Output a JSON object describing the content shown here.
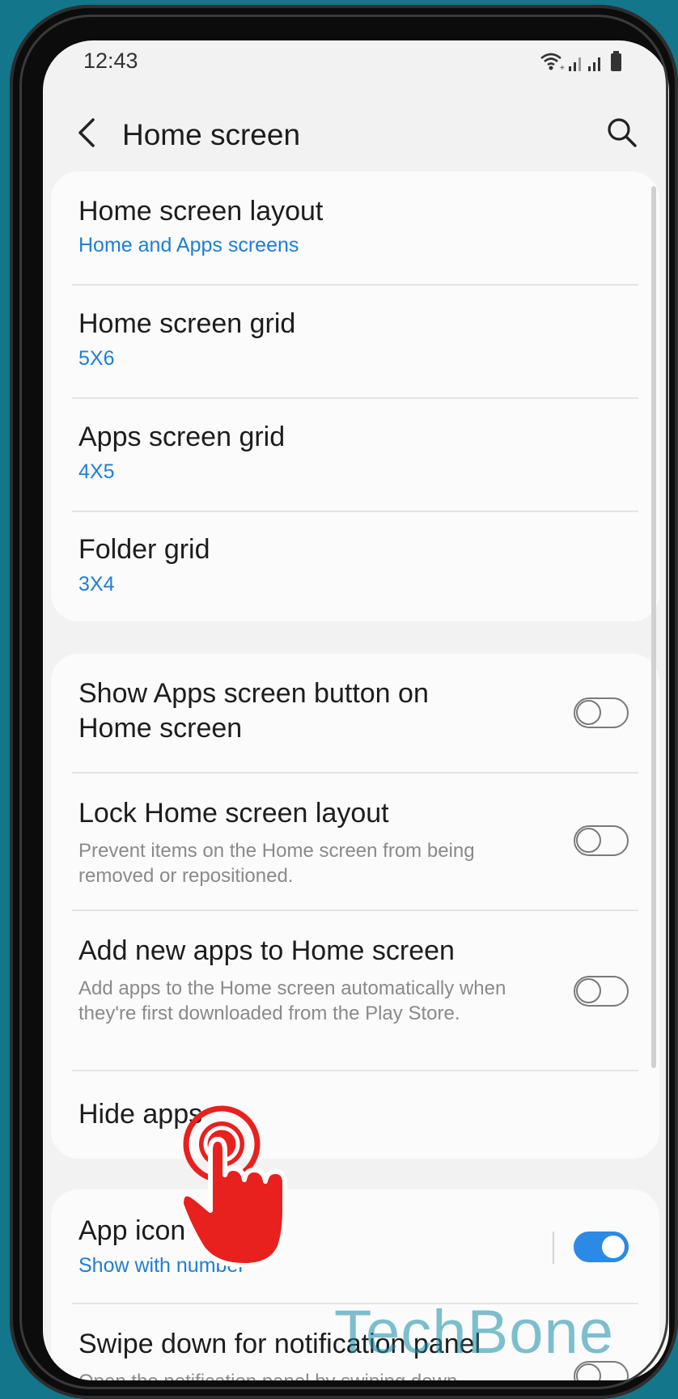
{
  "status_bar": {
    "time": "12:43"
  },
  "header": {
    "title": "Home screen"
  },
  "card1": [
    {
      "title": "Home screen layout",
      "value": "Home and Apps screens"
    },
    {
      "title": "Home screen grid",
      "value": "5X6"
    },
    {
      "title": "Apps screen grid",
      "value": "4X5"
    },
    {
      "title": "Folder grid",
      "value": "3X4"
    }
  ],
  "card2": {
    "show_apps_button": {
      "title": "Show Apps screen button on Home screen",
      "enabled": false
    },
    "lock_layout": {
      "title": "Lock Home screen layout",
      "description": "Prevent items on the Home screen from being removed or repositioned.",
      "enabled": false
    },
    "add_new_apps": {
      "title": "Add new apps to Home screen",
      "description": "Add apps to the Home screen automatically when they're first downloaded from the Play Store.",
      "enabled": false
    },
    "hide_apps": {
      "title": "Hide apps"
    }
  },
  "card3": {
    "app_icon_badges": {
      "title": "App icon badges",
      "value": "Show with number",
      "enabled": true
    },
    "swipe_down": {
      "title": "Swipe down for notification panel",
      "description": "Open the notification panel by swiping down",
      "enabled": false
    }
  },
  "watermark": "TechBone",
  "colors": {
    "accent": "#1f7ed6",
    "toggle_on": "#2a8ae6",
    "background": "#13768a",
    "pointer": "#e8201e"
  }
}
